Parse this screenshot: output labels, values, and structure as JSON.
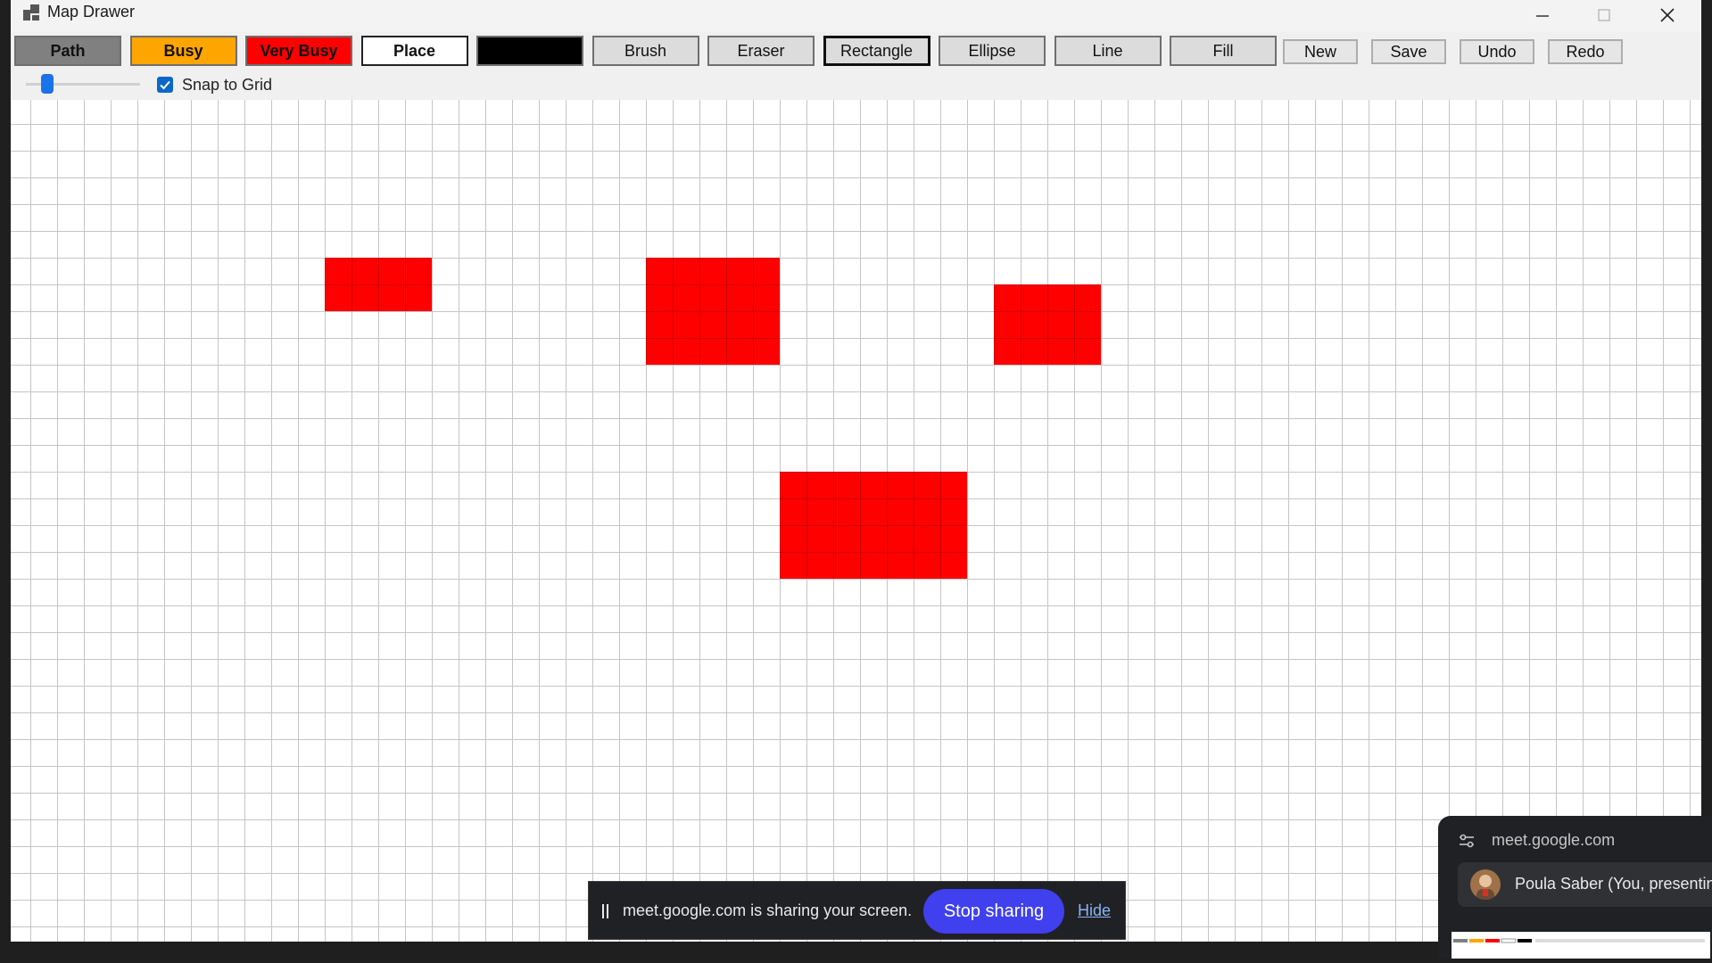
{
  "window": {
    "title": "Map Drawer",
    "controls": [
      "minimize",
      "maximize",
      "close"
    ]
  },
  "toolbar": {
    "tool_buttons": [
      {
        "name": "path",
        "label": "Path",
        "bg": "#808080"
      },
      {
        "name": "busy",
        "label": "Busy",
        "bg": "#ffa500"
      },
      {
        "name": "very-busy",
        "label": "Very Busy",
        "bg": "#ff0000"
      },
      {
        "name": "place",
        "label": "Place",
        "bg": "#ffffff"
      },
      {
        "name": "black",
        "label": "",
        "bg": "#000000"
      },
      {
        "name": "brush",
        "label": "Brush",
        "bg": "#dcdcdc"
      },
      {
        "name": "eraser",
        "label": "Eraser",
        "bg": "#dcdcdc"
      },
      {
        "name": "rectangle",
        "label": "Rectangle",
        "bg": "#dcdcdc",
        "selected": true
      },
      {
        "name": "ellipse",
        "label": "Ellipse",
        "bg": "#dcdcdc"
      },
      {
        "name": "line",
        "label": "Line",
        "bg": "#dcdcdc"
      },
      {
        "name": "fill",
        "label": "Fill",
        "bg": "#dcdcdc"
      }
    ],
    "action_buttons": [
      {
        "name": "new",
        "label": "New"
      },
      {
        "name": "save",
        "label": "Save"
      },
      {
        "name": "undo",
        "label": "Undo"
      },
      {
        "name": "redo",
        "label": "Redo"
      }
    ],
    "brush_size_level": 0.15,
    "snap_to_grid": {
      "label": "Snap to Grid",
      "checked": true
    }
  },
  "canvas": {
    "shape_color": "#ff0000",
    "grid_color": "#c5c5c5",
    "rectangles": [
      {
        "col": 11,
        "row": 5,
        "cols": 4,
        "rows": 2
      },
      {
        "col": 23,
        "row": 5,
        "cols": 5,
        "rows": 4
      },
      {
        "col": 36,
        "row": 6,
        "cols": 4,
        "rows": 3
      },
      {
        "col": 28,
        "row": 13,
        "cols": 7,
        "rows": 4
      }
    ]
  },
  "share_bar": {
    "message": "meet.google.com is sharing your screen.",
    "stop_label": "Stop sharing",
    "hide_label": "Hide"
  },
  "meet_panel": {
    "host": "meet.google.com",
    "participant": "Poula Saber (You, presentin"
  }
}
